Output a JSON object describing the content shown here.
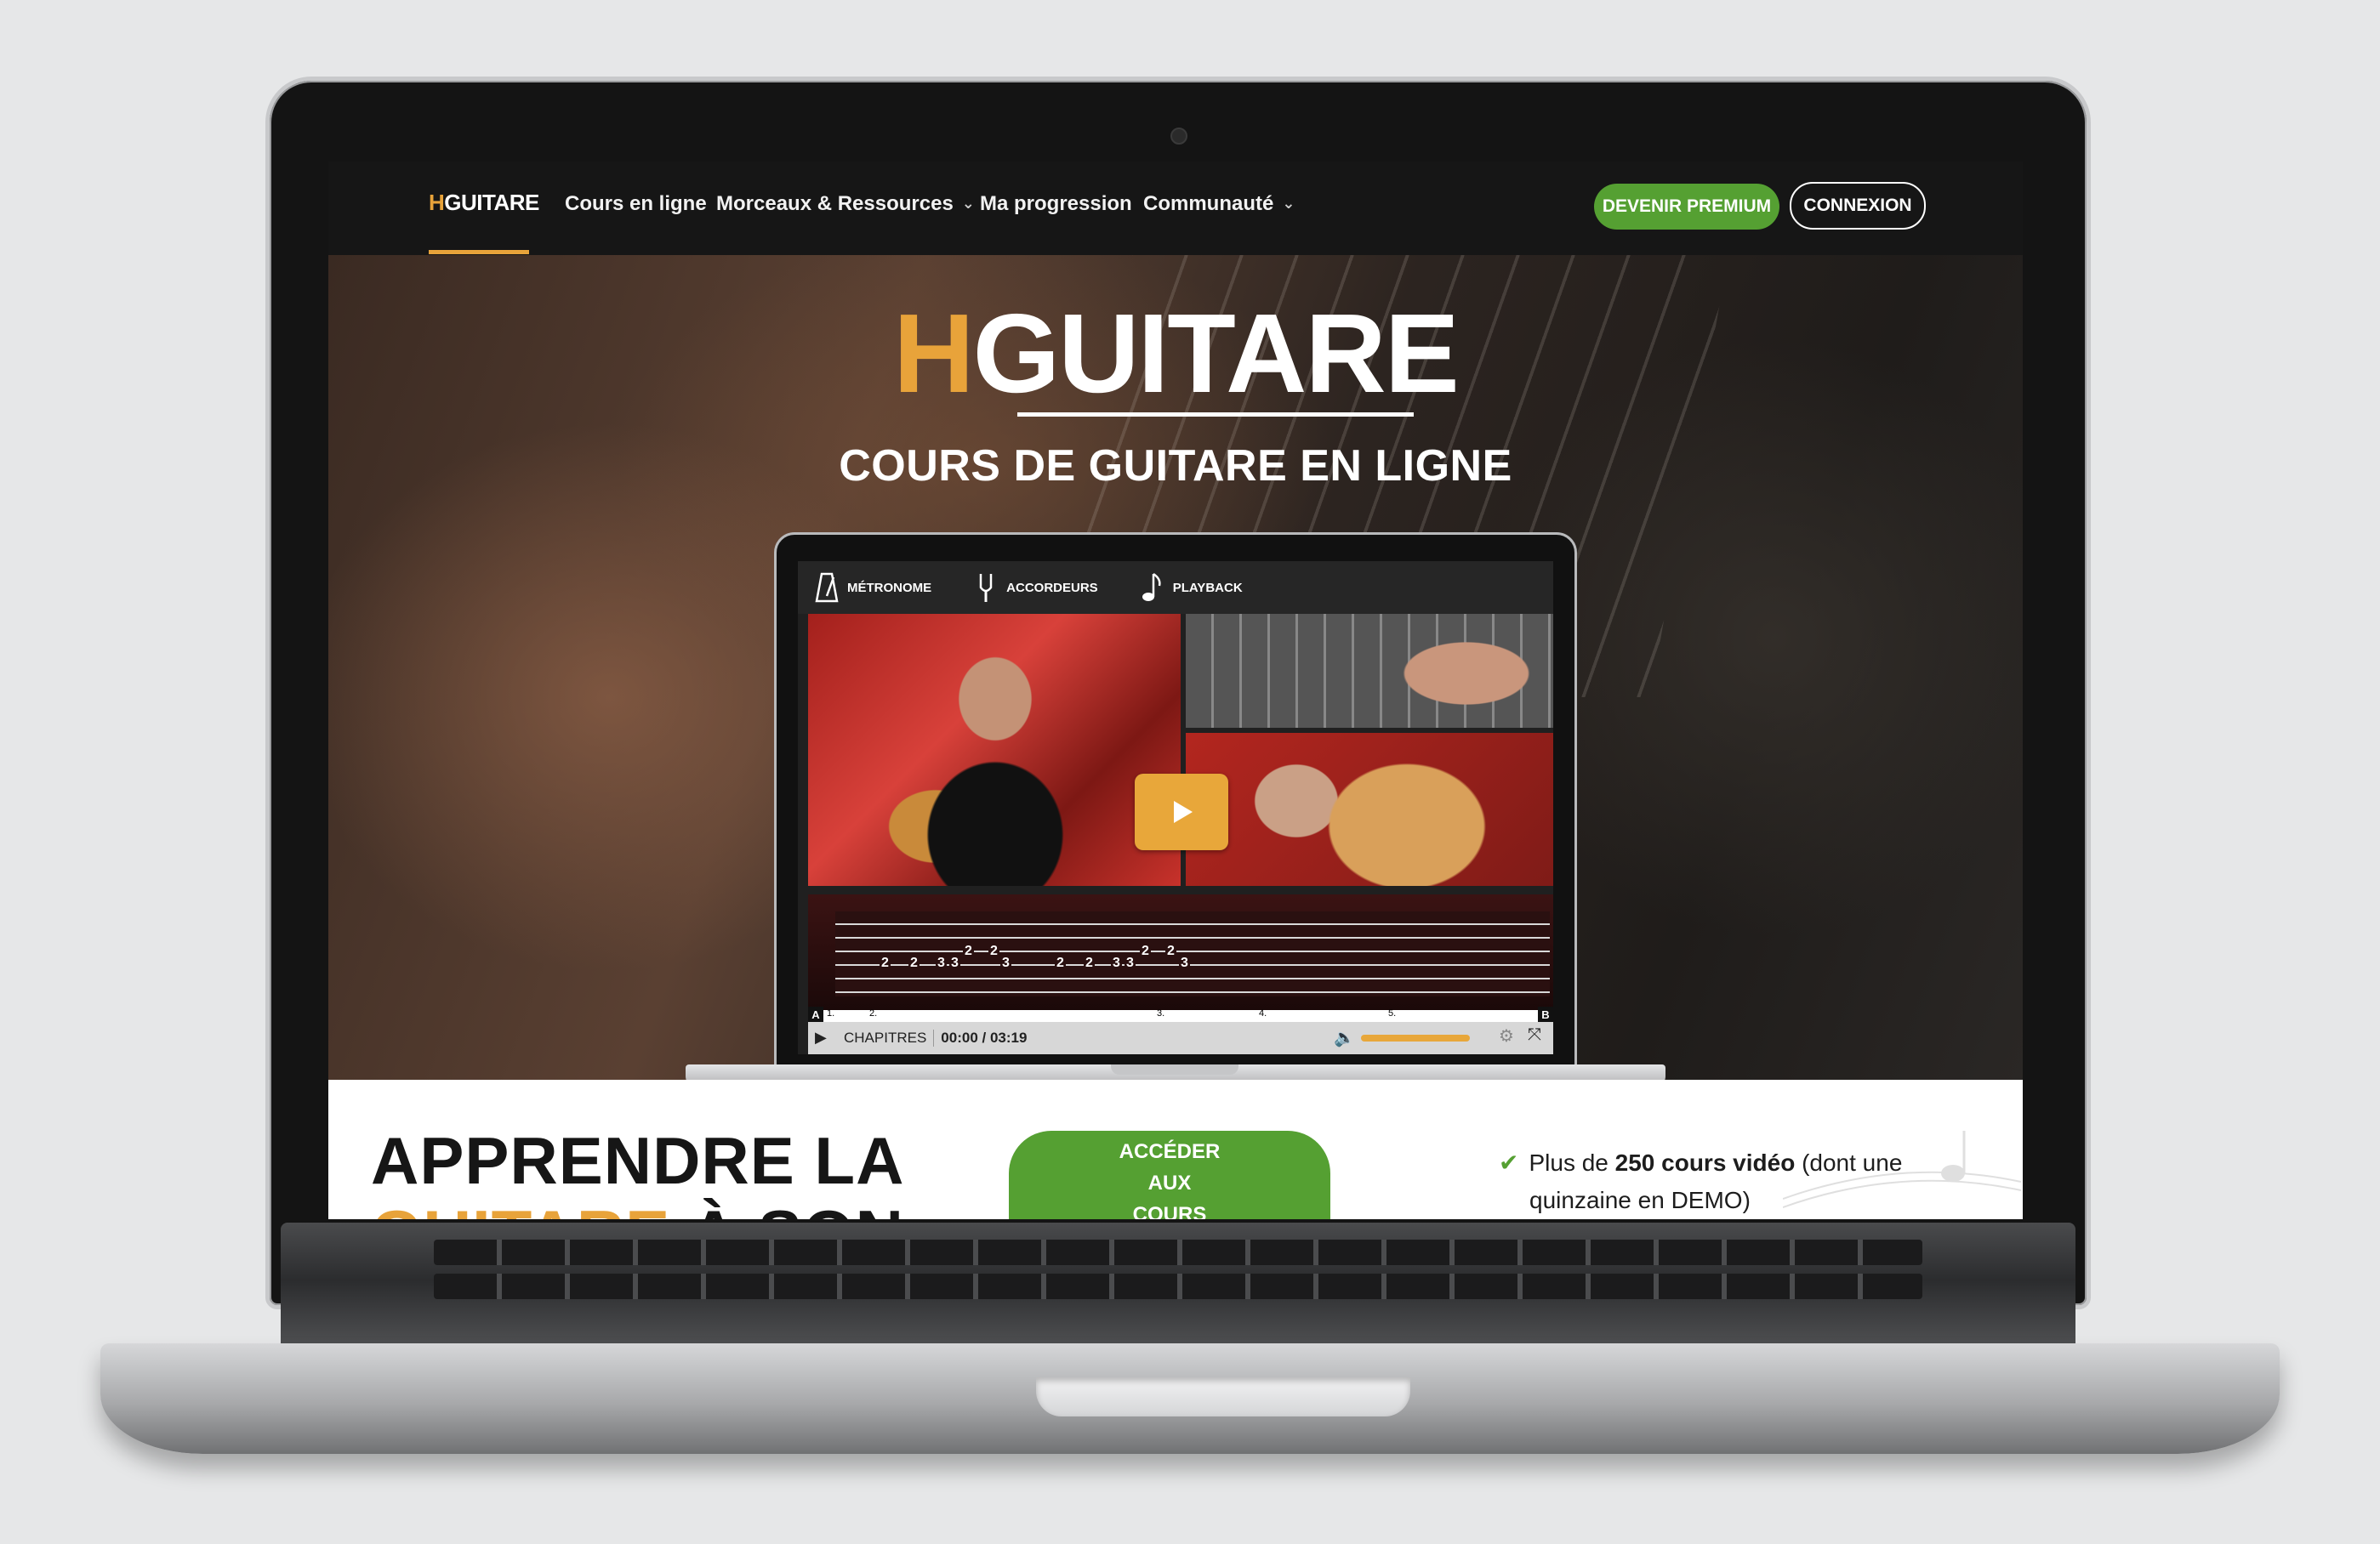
{
  "navbar": {
    "logo_h": "H",
    "logo_rest": "GUITARE",
    "items": [
      {
        "label": "Cours en ligne",
        "dropdown": false
      },
      {
        "label": "Morceaux & Ressources",
        "dropdown": true
      },
      {
        "label": "Ma progression",
        "dropdown": false
      },
      {
        "label": "Communauté",
        "dropdown": true
      }
    ],
    "premium_label": "DEVENIR PREMIUM",
    "login_label": "CONNEXION"
  },
  "hero": {
    "logo_h": "H",
    "logo_rest": "GUITARE",
    "subtitle": "COURS DE GUITARE EN LIGNE"
  },
  "player": {
    "tools": [
      "MÉTRONOME",
      "ACCORDEURS",
      "PLAYBACK"
    ],
    "tab_numbers": [
      "2",
      "2",
      "3",
      "3",
      "2",
      "2",
      "3",
      "2",
      "2",
      "3",
      "3",
      "2",
      "2",
      "3"
    ],
    "section_numbers": [
      "1.",
      "2.",
      "3.",
      "4.",
      "5."
    ],
    "marker_a": "A",
    "marker_b": "B",
    "chapters_label": "CHAPITRES",
    "time": "00:00 / 03:19",
    "volume": 1.0
  },
  "section": {
    "headline_line1": "APPRENDRE LA",
    "headline_orange": "GUITARE",
    "headline_rest": " À SON",
    "cta_lines": [
      "ACCÉDER",
      "AUX",
      "COURS"
    ],
    "feature_prefix": "Plus de ",
    "feature_bold": "250 cours vidéo",
    "feature_suffix": " (dont une",
    "feature_line2": "quinzaine en DEMO)"
  },
  "colors": {
    "accent_orange": "#e8a33a",
    "accent_green": "#55a032",
    "nav_bg": "#161616"
  }
}
